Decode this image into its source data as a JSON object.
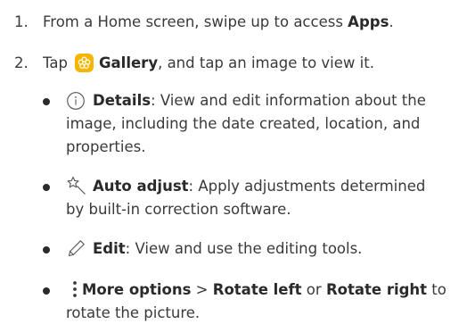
{
  "steps": [
    {
      "number": "1.",
      "pre": "From a Home screen, swipe up to access ",
      "bold": "Apps",
      "post": "."
    },
    {
      "number": "2.",
      "pre": "Tap ",
      "bold": "Gallery",
      "post": ", and tap an image to view it."
    }
  ],
  "bullets": [
    {
      "icon": "info-circle-icon",
      "title": "Details",
      "text_lines": [
        ": View and edit information about the",
        "image, including the date created, location, and",
        "properties."
      ]
    },
    {
      "icon": "auto-adjust-wand-icon",
      "title": "Auto adjust",
      "text_lines": [
        ": Apply adjustments determined",
        "by built-in correction software."
      ]
    },
    {
      "icon": "pencil-icon",
      "title": "Edit",
      "text_lines": [
        ": View and use the editing tools."
      ]
    },
    {
      "icon": "more-options-icon",
      "title": "More options",
      "sep": " > ",
      "opt1": "Rotate left",
      "or": " or ",
      "opt2": "Rotate right",
      "text_lines": [
        " to",
        "rotate the picture."
      ]
    }
  ],
  "colors": {
    "text": "#3a3a3a",
    "bold": "#2a2a2a",
    "gallery_icon": "#f7b500",
    "icon_stroke": "#3a3a3a"
  }
}
